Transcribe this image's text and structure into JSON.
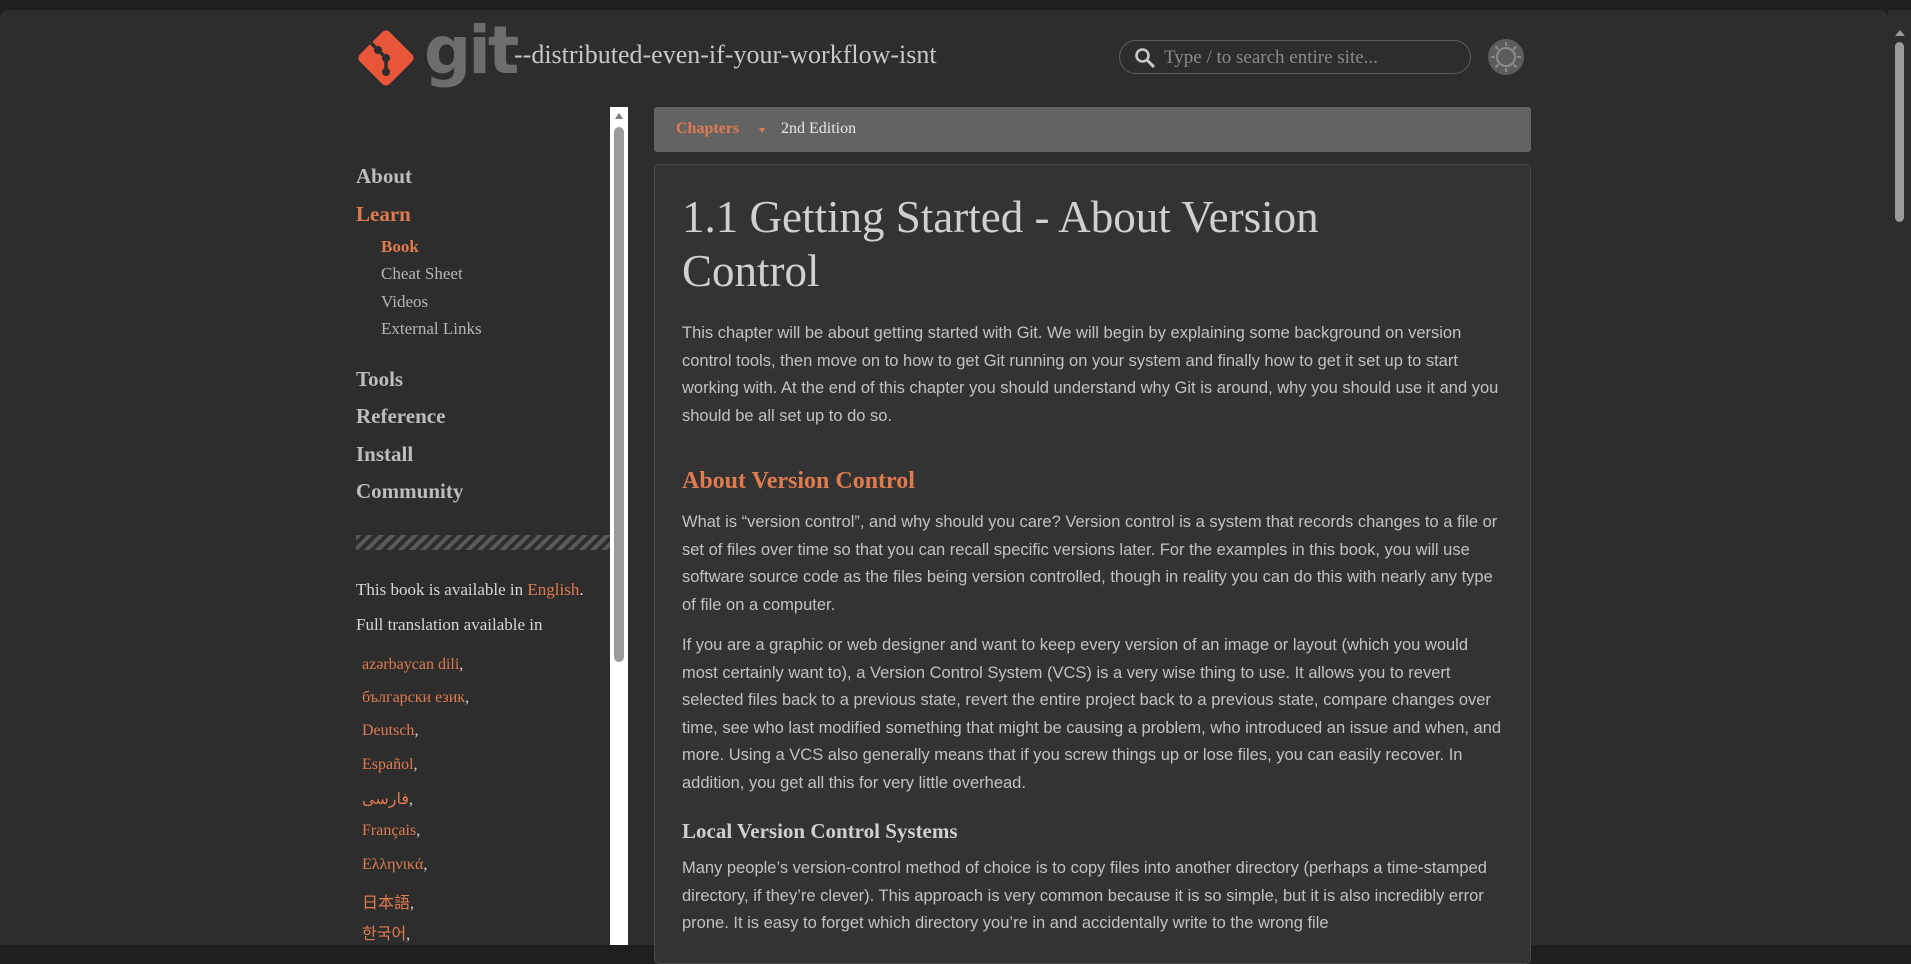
{
  "header": {
    "logo_text": "git",
    "tagline": "--distributed-even-if-your-workflow-isnt",
    "search_placeholder": "Type / to search entire site..."
  },
  "sidebar": {
    "nav": [
      {
        "label": "About"
      },
      {
        "label": "Learn"
      },
      {
        "label": "Tools"
      },
      {
        "label": "Reference"
      },
      {
        "label": "Install"
      },
      {
        "label": "Community"
      }
    ],
    "learn_sub": [
      {
        "label": "Book"
      },
      {
        "label": "Cheat Sheet"
      },
      {
        "label": "Videos"
      },
      {
        "label": "External Links"
      }
    ],
    "availability": {
      "prefix": "This book is available in ",
      "language": "English",
      "suffix": ".",
      "full_translation": "Full translation available in"
    },
    "languages": [
      "azərbaycan dili",
      "български език",
      "Deutsch",
      "Español",
      "فارسی",
      "Français",
      "Ελληνικά",
      "日本語",
      "한국어"
    ]
  },
  "chapters_bar": {
    "chapters_label": "Chapters",
    "edition": "2nd Edition"
  },
  "content": {
    "title_line1": "1.1 Getting Started - About Version",
    "title_line2": "Control",
    "intro": "This chapter will be about getting started with Git. We will begin by explaining some background on version control tools, then move on to how to get Git running on your system and finally how to get it set up to start working with. At the end of this chapter you should understand why Git is around, why you should use it and you should be all set up to do so.",
    "section_heading": "About Version Control",
    "para1": "What is “version control”, and why should you care? Version control is a system that records changes to a file or set of files over time so that you can recall specific versions later. For the examples in this book, you will use software source code as the files being version controlled, though in reality you can do this with nearly any type of file on a computer.",
    "para2": "If you are a graphic or web designer and want to keep every version of an image or layout (which you would most certainly want to), a Version Control System (VCS) is a very wise thing to use. It allows you to revert selected files back to a previous state, revert the entire project back to a previous state, compare changes over time, see who last modified something that might be causing a problem, who introduced an issue and when, and more. Using a VCS also generally means that if you screw things up or lose files, you can easily recover. In addition, you get all this for very little overhead.",
    "subsection_heading": "Local Version Control Systems",
    "para3": "Many people’s version-control method of choice is to copy files into another directory (perhaps a time-stamped directory, if they’re clever). This approach is very common because it is so simple, but it is also incredibly error prone. It is easy to forget which directory you’re in and accidentally write to the wrong file"
  },
  "colors": {
    "accent": "#e07b4f",
    "background": "#2d2d2d",
    "content_bg": "#333333"
  }
}
